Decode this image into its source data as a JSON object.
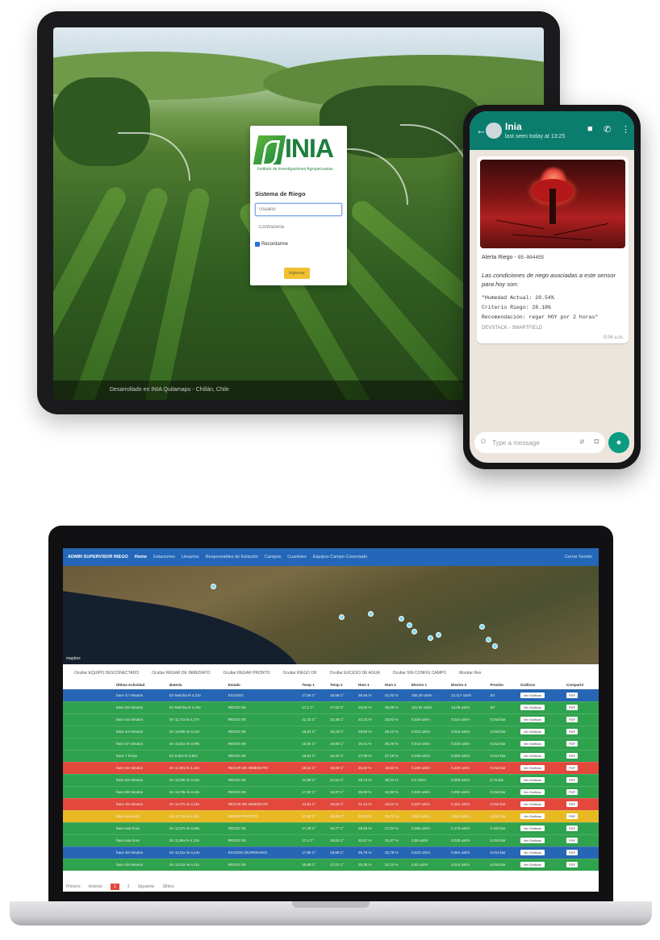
{
  "tablet": {
    "footer": "Desarrollado en INIA Quilamapu - Chillán, Chile",
    "login": {
      "logo_text": "INIA",
      "logo_subtitle": "Instituto de Investigaciones Agropecuarias",
      "title": "Sistema de Riego",
      "user_placeholder": "Usuario",
      "password_placeholder": "Contraseña",
      "remember_label": "Recordarme",
      "submit_label": "Ingresar"
    }
  },
  "phone": {
    "contact_name": "Inia",
    "contact_status": "last seen today at 13:25",
    "message": {
      "title": "Alerta Riego -",
      "sensor_id": "05-004455",
      "body": "Las condiciones de riego asociadas a este sensor para hoy son:",
      "line1": "\"Humedad Actual: 20.54%",
      "line2": "Criterio Riego: 28.18%",
      "line3": "Recomendación: regar HOY por 2 horas\"",
      "footer": "DEVSTACK - SMARTFIELD",
      "time": "9:06 a.m."
    },
    "input_placeholder": "Type a message"
  },
  "laptop": {
    "navbar": {
      "brand": "ADMIN SUPERVISOR RIEGO",
      "links": [
        "Home",
        "Estaciones",
        "Usuarios",
        "Responsables de Estación",
        "Campos",
        "Cuarteles",
        "Equipos Campo Conectado"
      ],
      "logout": "Cerrar Sesión"
    },
    "map_attribution": "mapbox",
    "filters": [
      "Ocultar EQUIPO DESCONECTADO",
      "Ocultar REGAR DE INMEDIATO",
      "Ocultar REGAR PRONTO",
      "Ocultar RIEGO OK",
      "Ocultar EXCESO DE AGUA",
      "Ocultar SIN CONFIG CAMPO",
      "Mostrar Res"
    ],
    "columns": [
      "Última Actividad",
      "Batería",
      "Estado",
      "Temp 1",
      "Temp 2",
      "Hum 1",
      "Hum 2",
      "Electro 1",
      "Electro 2",
      "Presión",
      "Gráficos",
      "Compartir"
    ],
    "grafico_label": "Ver Gráficos",
    "pdf_label": "PDF",
    "rows": [
      {
        "status": "blue",
        "cells": [
          "hace 47 minutos",
          "En Marcha le 4,22v",
          "EXCESO",
          "17,06 C°",
          "16,66 C°",
          "36,56 %",
          "41,02 %",
          "100,40 uS/m",
          "12,117 uS/m",
          "S/I"
        ]
      },
      {
        "status": "ok",
        "cells": [
          "hace 28 minutos",
          "En Marcha le 4,18v",
          "RIEGO OK",
          "17,1 C°",
          "17,63 C°",
          "33,92 %",
          "35,58 %",
          "101,91 uS/m",
          "14,06 uS/m",
          "S/I"
        ]
      },
      {
        "status": "ok",
        "cells": [
          "hace 34 minutos",
          "En 11,71v le 4,17v",
          "RIEGO OK",
          "21,43 C°",
          "22,46 C°",
          "22,33 %",
          "23,62 %",
          "0,026 uS/m",
          "0,014 uS/m",
          "0,018 bar"
        ]
      },
      {
        "status": "ok",
        "cells": [
          "hace 44 minutos",
          "En 13,90v le 4,14v",
          "RIEGO OK",
          "16,81 C°",
          "16,19 C°",
          "28,62 %",
          "29,12 %",
          "0,023 uS/m",
          "0,024 uS/m",
          "0,018 bar"
        ]
      },
      {
        "status": "ok",
        "cells": [
          "hace 37 minutos",
          "En 13,81v le 4,09v",
          "RIEGO OK",
          "15,84 C°",
          "19,95 C°",
          "19,41 %",
          "26,35 %",
          "0,013 uS/m",
          "0,033 uS/m",
          "0,013 bar"
        ]
      },
      {
        "status": "ok",
        "cells": [
          "hace 7 horas",
          "En 9,55v le 3,94v",
          "RIEGO OK",
          "16,81 C°",
          "16,42 C°",
          "27,96 %",
          "27,19 %",
          "0,046 uS/m",
          "0,092 uS/m",
          "0,012 bar"
        ]
      },
      {
        "status": "red",
        "cells": [
          "hace 46 minutos",
          "En 11,90v le 4,12v",
          "REGAR DE INMEDIATO",
          "18,51 C°",
          "19,09 C°",
          "25,82 %",
          "19,53 %",
          "0,189 uS/m",
          "0,226 uS/m",
          "0,016 bar"
        ]
      },
      {
        "status": "ok",
        "cells": [
          "hace 53 minutos",
          "En 13,09v le 4,10v",
          "RIEGO OK",
          "21,08 C°",
          "21,51 C°",
          "29,73 %",
          "30,24 %",
          "0,2 uS/m",
          "0,083 uS/m",
          "0,75 bar"
        ]
      },
      {
        "status": "ok",
        "cells": [
          "hace 58 minutos",
          "En 13,75v le 4,13v",
          "RIEGO OK",
          "17,92 C°",
          "16,87 C°",
          "28,83 %",
          "22,93 %",
          "0,022 uS/m",
          "0,092 uS/m",
          "0,018 bar"
        ]
      },
      {
        "status": "red",
        "cells": [
          "hace 38 minutos",
          "En 12,07v le 4,15v",
          "REGAR DE INMEDIATO",
          "14,52 C°",
          "19,63 C°",
          "21,12 %",
          "19,52 %",
          "0,207 uS/m",
          "0,161 uS/m",
          "0,016 bar"
        ]
      },
      {
        "status": "yellow",
        "cells": [
          "hace una hora",
          "En 11,72v le 4,02v",
          "REGAR PRONTO",
          "17,65 C°",
          "19,06 C°",
          "24,55 %",
          "26,71 %",
          "0,051 uS/m",
          "0,081 uS/m",
          "0,212 bar"
        ]
      },
      {
        "status": "ok",
        "cells": [
          "hace una hora",
          "En 12,57v le 4,06v",
          "RIEGO OK",
          "17,49 C°",
          "16,77 C°",
          "28,56 %",
          "27,04 %",
          "0,285 uS/m",
          "0,179 uS/m",
          "0,403 bar"
        ]
      },
      {
        "status": "ok",
        "cells": [
          "hace una hora",
          "En 11,86v le 4,13v",
          "RIEGO OK",
          "17,4 C°",
          "19,63 C°",
          "33,67 %",
          "31,87 %",
          "0,06 uS/m",
          "0,025 uS/m",
          "0,018 bar"
        ]
      },
      {
        "status": "blue",
        "cells": [
          "hace 30 minutos",
          "En 12,01v le 4,14v",
          "EXCESO (SUPERADO)",
          "17,85 C°",
          "18,58 C°",
          "26,75 %",
          "32,78 %",
          "0,023 uS/m",
          "0,051 uS/m",
          "0,014 bar"
        ]
      },
      {
        "status": "ok",
        "cells": [
          "hace 28 minutos",
          "En 13,41v le 4,11v",
          "RIEGO OK",
          "15,88 C°",
          "17,01 C°",
          "25,38 %",
          "32,14 %",
          "0,02 uS/m",
          "0,024 uS/m",
          "0,018 bar"
        ]
      }
    ],
    "pager": {
      "prev": "Primero",
      "back": "Anterior",
      "current": "1",
      "next_page": "2",
      "next": "Siguiente",
      "last": "Último"
    }
  }
}
